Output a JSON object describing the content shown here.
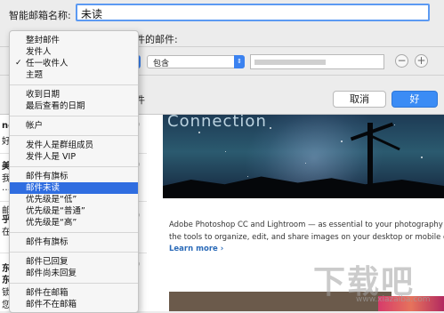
{
  "sheet": {
    "name_label": "智能邮箱名称:",
    "name_value": "未读",
    "condition_suffix": "件的邮件:",
    "operator": "包含",
    "cut_label": "件",
    "cancel_label": "取消",
    "ok_label": "好",
    "remove_btn": "−",
    "add_btn": "+"
  },
  "menu": {
    "groups": [
      [
        {
          "label": "整封邮件"
        },
        {
          "label": "发件人"
        },
        {
          "label": "任一收件人",
          "checked": true
        },
        {
          "label": "主题"
        }
      ],
      [
        {
          "label": "收到日期"
        },
        {
          "label": "最后查看的日期"
        }
      ],
      [
        {
          "label": "帐户"
        }
      ],
      [
        {
          "label": "发件人是群组成员"
        },
        {
          "label": "发件人是 VIP"
        }
      ],
      [
        {
          "label": "邮件有旗标"
        },
        {
          "label": "邮件未读",
          "selected": true
        },
        {
          "label": "优先级是“低”"
        },
        {
          "label": "优先级是“普通”"
        },
        {
          "label": "优先级是“高”"
        }
      ],
      [
        {
          "label": "邮件有旗标"
        }
      ],
      [
        {
          "label": "邮件已回复"
        },
        {
          "label": "邮件尚未回复"
        }
      ],
      [
        {
          "label": "邮件在邮箱"
        },
        {
          "label": "邮件不在邮箱"
        }
      ]
    ],
    "check_mark": "✓"
  },
  "mail_list": {
    "fragments": [
      "new",
      "好",
      "美和",
      "我",
      "…",
      "邮",
      "乎在",
      "在",
      "东J",
      "东d",
      "锁",
      "您"
    ],
    "right_marks": [
      "Q",
      "Q",
      "Q",
      "Q"
    ]
  },
  "content": {
    "banner_title": "Connection",
    "promo_lines": [
      "Adobe Photoshop CC and Lightroom — as essential to your photography a",
      "the tools to organize, edit, and share images on your desktop or mobile dev"
    ],
    "learn_more": "Learn more ›"
  },
  "watermark": {
    "text": "下载吧",
    "sub": "www.xiazaiba.com"
  },
  "colors": {
    "accent": "#3b8cf5",
    "menu_highlight": "#2f6de0",
    "focus_ring": "#5c9af2"
  }
}
